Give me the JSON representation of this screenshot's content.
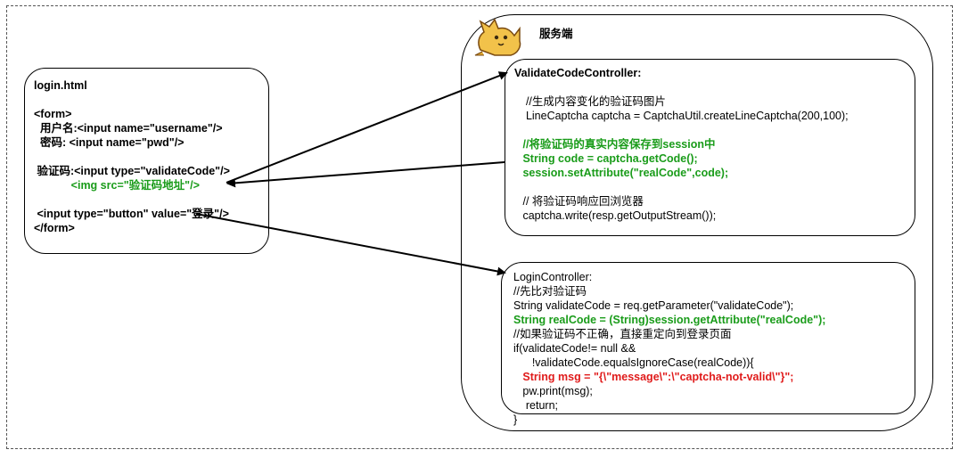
{
  "server": {
    "title": "服务端",
    "icon": "tomcat-icon"
  },
  "login_html": {
    "lines": [
      "login.html",
      "",
      "<form>",
      "  用户名:<input name=\"username\"/>",
      "  密码: <input name=\"pwd\"/>",
      "",
      " 验证码:<input type=\"validateCode\"/>",
      "            <img src=\"验证码地址\"/>",
      "",
      " <input type=\"button\" value=\"登录\"/>",
      "</form>"
    ]
  },
  "validate_controller": {
    "lines": [
      "ValidateCodeController:",
      "",
      "  //生成内容变化的验证码图片",
      "  LineCaptcha captcha = CaptchaUtil.createLineCaptcha(200,100);",
      "",
      " //将验证码的真实内容保存到session中",
      " String code = captcha.getCode();",
      " session.setAttribute(\"realCode\",code);",
      "",
      " // 将验证码响应回浏览器",
      " captcha.write(resp.getOutputStream());"
    ]
  },
  "login_controller": {
    "lines": [
      "LoginController:",
      "//先比对验证码",
      "String validateCode = req.getParameter(\"validateCode\");",
      "String realCode = (String)session.getAttribute(\"realCode\");",
      "//如果验证码不正确，直接重定向到登录页面",
      "if(validateCode!= null &&",
      "      !validateCode.equalsIgnoreCase(realCode)){",
      "   String msg = \"{\\\"message\\\":\\\"captcha-not-valid\\\"}\";",
      "   pw.print(msg);",
      "    return;",
      "}"
    ]
  },
  "colors": {
    "green": "#1a9c1a",
    "red": "#e01b1b"
  }
}
